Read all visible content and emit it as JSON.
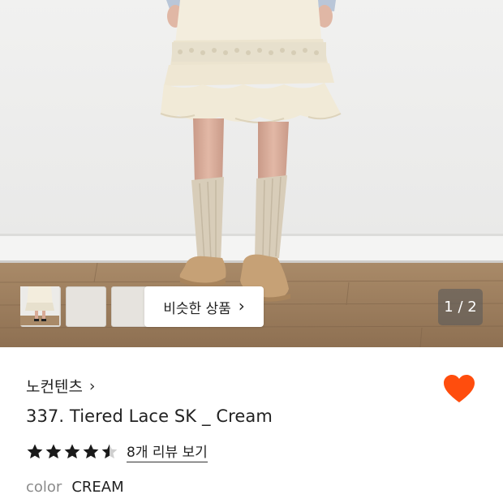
{
  "product_image": {
    "alt": "",
    "counter": "1 / 2",
    "thumbnails": [
      "thumbnail-1",
      "thumbnail-2",
      "thumbnail-3"
    ],
    "similar_button": {
      "label": "비슷한 상품",
      "chevron": "›"
    }
  },
  "brand": {
    "name": "노컨텐츠",
    "chevron": "›"
  },
  "wishlist": {
    "icon": "heart-icon",
    "color": "#ff4d0d",
    "active": true
  },
  "product": {
    "title": "337. Tiered Lace SK _ Cream"
  },
  "rating": {
    "value": 4.5,
    "max": 5,
    "review_link": "8개 리뷰 보기"
  },
  "option": {
    "label": "color",
    "value": "CREAM"
  },
  "colors": {
    "accent": "#ff4d0d",
    "star": "#1a1a1a",
    "star_empty": "#cfcfcf"
  }
}
